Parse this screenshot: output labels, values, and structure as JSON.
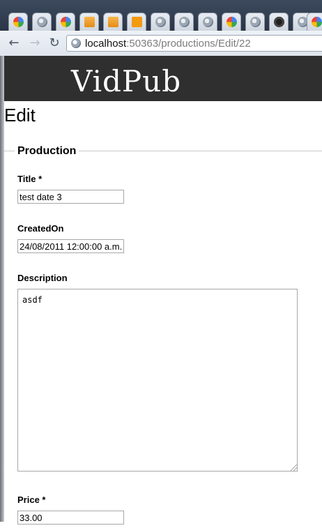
{
  "browser": {
    "tabs": [
      {
        "icon": "google-icon"
      },
      {
        "icon": "globe-icon"
      },
      {
        "icon": "google-icon"
      },
      {
        "icon": "stackoverflow-icon"
      },
      {
        "icon": "stackoverflow-icon"
      },
      {
        "icon": "orange-square-icon"
      },
      {
        "icon": "globe-icon"
      },
      {
        "icon": "globe-icon"
      },
      {
        "icon": "globe-icon"
      },
      {
        "icon": "google-icon"
      },
      {
        "icon": "globe-icon"
      },
      {
        "icon": "github-icon"
      },
      {
        "icon": "globe-icon"
      },
      {
        "icon": "globe-icon"
      },
      {
        "icon": "google-icon"
      }
    ],
    "url_host": "localhost",
    "url_rest": ":50363/productions/Edit/22"
  },
  "site": {
    "logo": "VidPub"
  },
  "page": {
    "title": "Edit"
  },
  "form": {
    "legend": "Production",
    "title_label": "Title *",
    "title_value": "test date 3",
    "created_label": "CreatedOn",
    "created_value": "24/08/2011 12:00:00 a.m.",
    "description_label": "Description",
    "description_value": "asdf",
    "price_label": "Price *",
    "price_value": "33.00"
  }
}
